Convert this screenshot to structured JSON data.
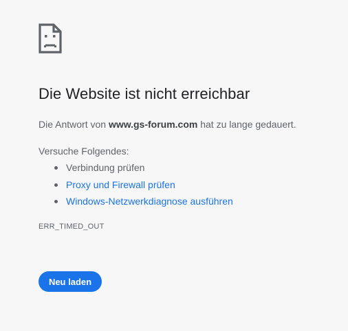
{
  "icon": "sad-document-icon",
  "title": "Die Website ist nicht erreichbar",
  "summary": {
    "prefix": "Die Antwort von ",
    "host": "www.gs-forum.com",
    "suffix": " hat zu lange gedauert."
  },
  "suggestions": {
    "heading": "Versuche Folgendes:",
    "items": [
      {
        "label": "Verbindung prüfen",
        "is_link": false
      },
      {
        "label": "Proxy und Firewall prüfen",
        "is_link": true
      },
      {
        "label": "Windows-Netzwerkdiagnose ausführen",
        "is_link": true
      }
    ]
  },
  "error_code": "ERR_TIMED_OUT",
  "reload_button": {
    "label": "Neu laden"
  },
  "colors": {
    "background": "#f7f7f7",
    "text": "#202124",
    "muted": "#5f6368",
    "link": "#1a73e8",
    "button": "#1a73e8"
  }
}
